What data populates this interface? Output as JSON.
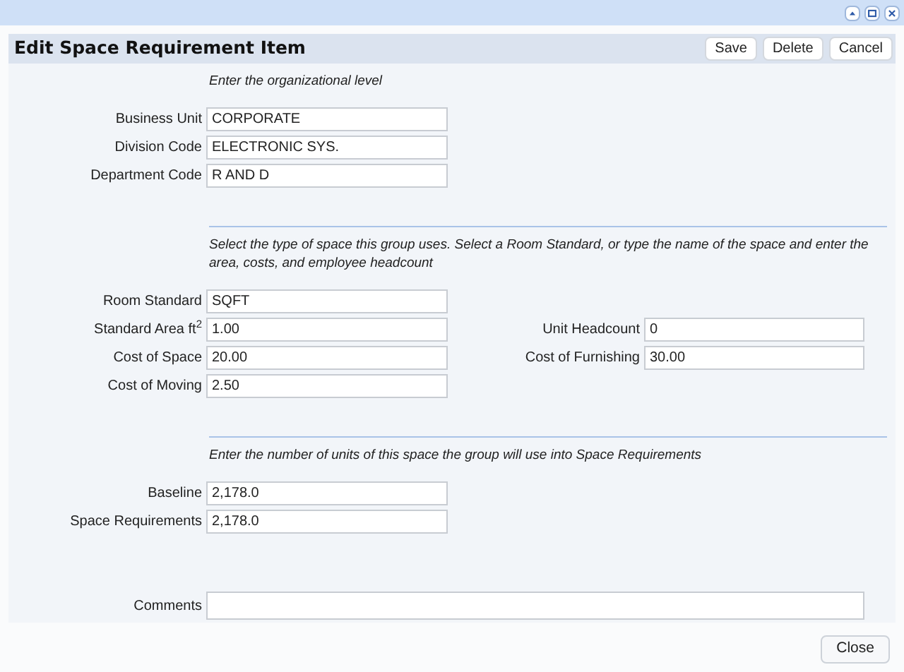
{
  "window": {
    "controls": [
      {
        "kind": "restore"
      },
      {
        "kind": "maximize"
      },
      {
        "kind": "close"
      }
    ]
  },
  "header": {
    "title": "Edit Space Requirement Item",
    "buttons": [
      "Save",
      "Delete",
      "Cancel"
    ]
  },
  "sections": [
    {
      "instruction": "Enter the organizational level",
      "divider": false,
      "rows": [
        {
          "left": {
            "label": "Business Unit",
            "value": "CORPORATE"
          }
        },
        {
          "left": {
            "label": "Division Code",
            "value": "ELECTRONIC SYS."
          }
        },
        {
          "left": {
            "label": "Department Code",
            "value": "R AND D"
          }
        }
      ]
    },
    {
      "instruction": "Select the type of space this group uses. Select a Room Standard, or type the name of the space and enter the area, costs, and employee headcount",
      "divider": true,
      "rows": [
        {
          "left": {
            "label": "Room Standard",
            "value": "SQFT"
          }
        },
        {
          "left": {
            "label": "Standard Area ft$^{2}$",
            "value": "1.00"
          },
          "right": {
            "label": "Unit Headcount",
            "value": "0"
          }
        },
        {
          "left": {
            "label": "Cost of Space",
            "value": "20.00"
          },
          "right": {
            "label": "Cost of Furnishing",
            "value": "30.00"
          }
        },
        {
          "left": {
            "label": "Cost of Moving",
            "value": "2.50"
          }
        }
      ]
    },
    {
      "instruction": "Enter the number of units of this space the group will use into Space Requirements",
      "divider": true,
      "rows": [
        {
          "left": {
            "label": "Baseline",
            "value": "2,178.0"
          }
        },
        {
          "left": {
            "label": "Space Requirements",
            "value": "2,178.0"
          }
        }
      ]
    }
  ],
  "comments": {
    "label": "Comments"
  },
  "footer": {
    "buttons": [
      "Close"
    ]
  }
}
